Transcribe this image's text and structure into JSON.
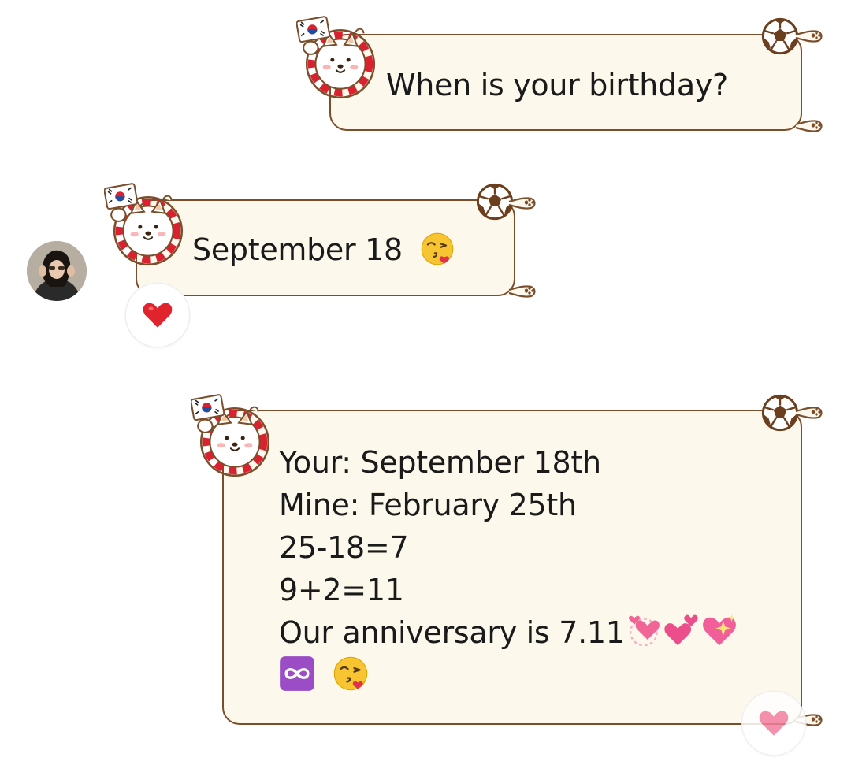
{
  "messages": [
    {
      "id": "m1",
      "sender": "me",
      "lines": [
        "When is your birthday?"
      ]
    },
    {
      "id": "m2",
      "sender": "them",
      "lines": [
        "September 18"
      ],
      "trailing_emoji": "kissing-face-with-heart-emoji",
      "reaction": "red-heart-emoji"
    },
    {
      "id": "m3",
      "sender": "me",
      "lines": [
        "Your: September 18th",
        "Mine: February 25th",
        "25-18=7",
        "9+2=11",
        "Our anniversary is 7.11"
      ],
      "line5_emojis": [
        "revolving-hearts-emoji",
        "two-hearts-emoji",
        "sparkling-heart-emoji"
      ],
      "line6_emojis": [
        "infinity-emoji",
        "kissing-face-with-heart-emoji"
      ],
      "reaction": "red-heart-emoji"
    }
  ],
  "bubble_theme": {
    "sticker": "shiba-dog-korea-flag",
    "corner_icon": "soccer-ball-icon",
    "fill": "#fdf8ec",
    "border": "#7a4e2a"
  }
}
